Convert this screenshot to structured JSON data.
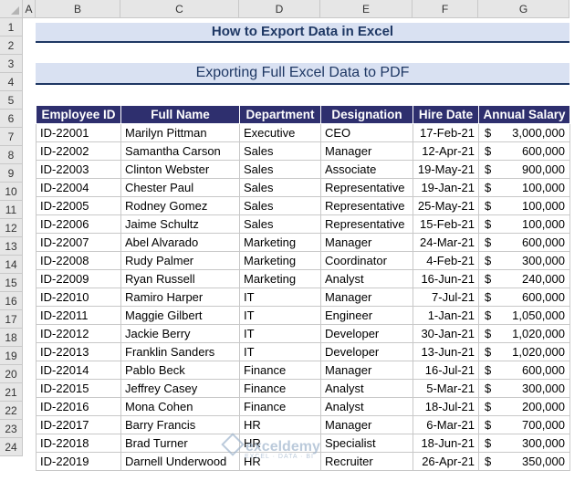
{
  "columns": [
    "A",
    "B",
    "C",
    "D",
    "E",
    "F",
    "G"
  ],
  "rows": [
    "1",
    "2",
    "3",
    "4",
    "5",
    "6",
    "7",
    "8",
    "9",
    "10",
    "11",
    "12",
    "13",
    "14",
    "15",
    "16",
    "17",
    "18",
    "19",
    "20",
    "21",
    "22",
    "23",
    "24"
  ],
  "titles": {
    "main": "How to Export Data in Excel",
    "sub": "Exporting Full Excel Data to PDF"
  },
  "table": {
    "headers": [
      "Employee ID",
      "Full Name",
      "Department",
      "Designation",
      "Hire Date",
      "Annual Salary"
    ],
    "currency": "$",
    "rows": [
      [
        "ID-22001",
        "Marilyn Pittman",
        "Executive",
        "CEO",
        "17-Feb-21",
        "3,000,000"
      ],
      [
        "ID-22002",
        "Samantha Carson",
        "Sales",
        "Manager",
        "12-Apr-21",
        "600,000"
      ],
      [
        "ID-22003",
        "Clinton Webster",
        "Sales",
        "Associate",
        "19-May-21",
        "900,000"
      ],
      [
        "ID-22004",
        "Chester Paul",
        "Sales",
        "Representative",
        "19-Jan-21",
        "100,000"
      ],
      [
        "ID-22005",
        "Rodney Gomez",
        "Sales",
        "Representative",
        "25-May-21",
        "100,000"
      ],
      [
        "ID-22006",
        "Jaime Schultz",
        "Sales",
        "Representative",
        "15-Feb-21",
        "100,000"
      ],
      [
        "ID-22007",
        "Abel Alvarado",
        "Marketing",
        "Manager",
        "24-Mar-21",
        "600,000"
      ],
      [
        "ID-22008",
        "Rudy Palmer",
        "Marketing",
        "Coordinator",
        "4-Feb-21",
        "300,000"
      ],
      [
        "ID-22009",
        "Ryan Russell",
        "Marketing",
        "Analyst",
        "16-Jun-21",
        "240,000"
      ],
      [
        "ID-22010",
        "Ramiro Harper",
        "IT",
        "Manager",
        "7-Jul-21",
        "600,000"
      ],
      [
        "ID-22011",
        "Maggie Gilbert",
        "IT",
        "Engineer",
        "1-Jan-21",
        "1,050,000"
      ],
      [
        "ID-22012",
        "Jackie Berry",
        "IT",
        "Developer",
        "30-Jan-21",
        "1,020,000"
      ],
      [
        "ID-22013",
        "Franklin Sanders",
        "IT",
        "Developer",
        "13-Jun-21",
        "1,020,000"
      ],
      [
        "ID-22014",
        "Pablo Beck",
        "Finance",
        "Manager",
        "16-Jul-21",
        "600,000"
      ],
      [
        "ID-22015",
        "Jeffrey Casey",
        "Finance",
        "Analyst",
        "5-Mar-21",
        "300,000"
      ],
      [
        "ID-22016",
        "Mona Cohen",
        "Finance",
        "Analyst",
        "18-Jul-21",
        "200,000"
      ],
      [
        "ID-22017",
        "Barry Francis",
        "HR",
        "Manager",
        "6-Mar-21",
        "700,000"
      ],
      [
        "ID-22018",
        "Brad Turner",
        "HR",
        "Specialist",
        "18-Jun-21",
        "300,000"
      ],
      [
        "ID-22019",
        "Darnell Underwood",
        "HR",
        "Recruiter",
        "26-Apr-21",
        "350,000"
      ]
    ]
  },
  "watermark": {
    "name": "exceldemy",
    "tagline": "EXCEL · DATA · BI"
  }
}
